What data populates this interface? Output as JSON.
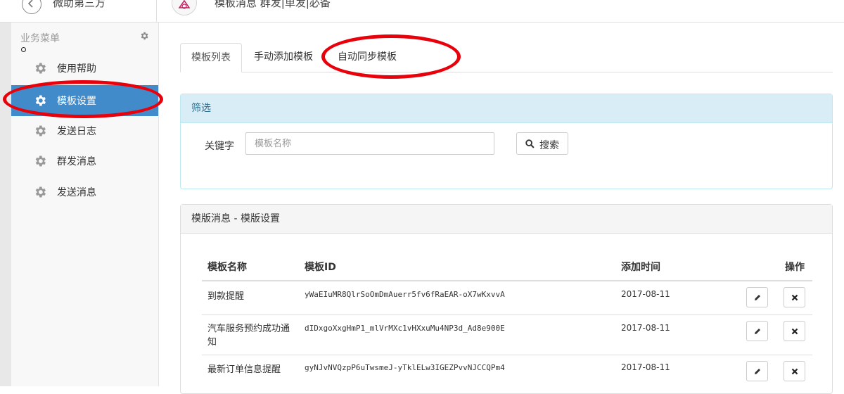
{
  "topbar": {
    "app_name": "微助第三方",
    "page_heading": "模板消息 群发|单发|必备"
  },
  "sidebar": {
    "title": "业务菜单",
    "items": [
      {
        "label": "使用帮助",
        "active": false
      },
      {
        "label": "模板设置",
        "active": true
      },
      {
        "label": "发送日志",
        "active": false
      },
      {
        "label": "群发消息",
        "active": false
      },
      {
        "label": "发送消息",
        "active": false
      }
    ]
  },
  "tabs": [
    {
      "label": "模板列表",
      "active": true
    },
    {
      "label": "手动添加模板",
      "active": false
    },
    {
      "label": "自动同步模板",
      "active": false
    }
  ],
  "filter": {
    "heading": "筛选",
    "keyword_label": "关键字",
    "keyword_placeholder": "模板名称",
    "keyword_value": "",
    "search_label": "搜索"
  },
  "list": {
    "heading": "模版消息 - 模版设置",
    "columns": [
      "模板名称",
      "模板ID",
      "添加时间",
      "操作"
    ],
    "rows": [
      {
        "name": "到款提醒",
        "id": "yWaEIuMR8QlrSoOmDmAuerr5fv6fRaEAR-oX7wKxvvA",
        "time": "2017-08-11"
      },
      {
        "name": "汽车服务预约成功通知",
        "id": "dIDxgoXxgHmP1_mlVrMXc1vHXxuMu4NP3d_Ad8e900E",
        "time": "2017-08-11"
      },
      {
        "name": "最新订单信息提醒",
        "id": "gyNJvNVQzpP6uTwsmeJ-yTklELw3IGEZPvvNJCCQPm4",
        "time": "2017-08-11"
      }
    ]
  },
  "colors": {
    "accent": "#428bca",
    "annotation": "#e8000b",
    "info_heading_bg": "#d9edf7"
  }
}
